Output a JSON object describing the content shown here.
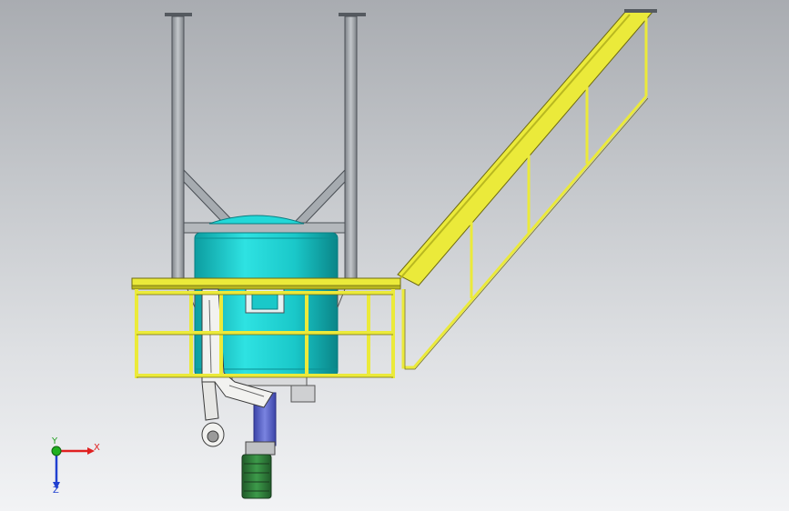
{
  "scene": {
    "model": "reactor-vessel-platform-assembly",
    "colors": {
      "background_top": "#a9acb1",
      "background_bottom": "#f2f3f5",
      "steel": "#9ea3a8",
      "steel_dark": "#4a4f55",
      "vessel": "#1ad4d4",
      "vessel_dark": "#0a8f92",
      "railing": "#ebea3a",
      "railing_dark": "#6e6a10",
      "motor": "#2f7a3a",
      "gearbox": "#5a64c8"
    }
  },
  "triad": {
    "x_label": "X",
    "y_label": "Y",
    "z_label": "Z",
    "colors": {
      "x": "#e02020",
      "y": "#20b020",
      "z": "#2040d0"
    }
  }
}
